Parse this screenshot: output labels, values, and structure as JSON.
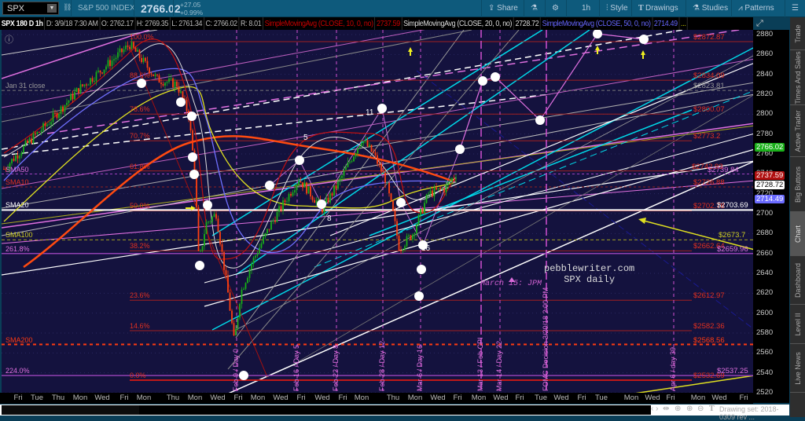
{
  "toolbar": {
    "symbol": "SPX",
    "name": "S&P 500 INDEX",
    "last": "2766.02",
    "change": "+27.05",
    "change_pct": "+0.99%",
    "share": "Share",
    "interval": "1h",
    "style": "Style",
    "drawings": "Drawings",
    "studies": "Studies",
    "patterns": "Patterns"
  },
  "infobar": {
    "title": "SPX 180 D 1h",
    "date": "D: 3/9/18 7:30 AM",
    "open": "O: 2762.17",
    "high": "H: 2769.35",
    "low": "L: 2761.34",
    "close": "C: 2766.02",
    "range": "R: 8.01",
    "sma10_label": "SimpleMovingAvg (CLOSE, 10, 0, no)",
    "sma10_value": "2737.59",
    "sma20_label": "SimpleMovingAvg (CLOSE, 20, 0, no)",
    "sma20_value": "2728.72",
    "sma50_label": "SimpleMovingAvg (CLOSE, 50, 0, no)",
    "sma50_value": "2714.49",
    "more": "..."
  },
  "price_axis": [
    "2880",
    "2860",
    "2840",
    "2820",
    "2800",
    "2780",
    "2760",
    "2740",
    "2720",
    "2700",
    "2680",
    "2660",
    "2640",
    "2620",
    "2600",
    "2580",
    "2560",
    "2540",
    "2520"
  ],
  "price_tags": {
    "last": "2766.02",
    "sma10": "2737.59",
    "sma20": "2728.72",
    "sma50": "2714.49"
  },
  "fib_levels": [
    {
      "pct": "100.0%",
      "price": "$2872.87"
    },
    {
      "pct": "88.6%",
      "price": "$2834.09"
    },
    {
      "pct": "78.6%",
      "price": "$2800.07"
    },
    {
      "pct": "70.7%",
      "price": "$2773.2"
    },
    {
      "pct": "61.8%",
      "price": "$2742.93"
    },
    {
      "pct": "50.0%",
      "price": "$2702.78"
    },
    {
      "pct": "38.2%",
      "price": "$2662.64"
    },
    {
      "pct": "23.6%",
      "price": "$2612.97"
    },
    {
      "pct": "14.6%",
      "price": "$2582.36"
    },
    {
      "pct": "0.0%",
      "price": "$2532.69"
    }
  ],
  "ext_levels": [
    {
      "pct": "261.8%",
      "price": "$2659.96"
    },
    {
      "pct": "224.0%",
      "price": "$2537.25"
    }
  ],
  "line_labels": {
    "jan31": "Jan 31 close",
    "jan31_price": "$2823.81",
    "sma50": "SMA50",
    "sma50_price": "$2739.84",
    "sma10": "SMA10",
    "sma10_price": "$2726.88",
    "sma20": "SMA20",
    "sma20_price": "$2703.69",
    "sma100": "SMA100",
    "sma100_price": "$2673.7",
    "sma200": "SMA200",
    "sma200_price": "$2568.56"
  },
  "wave_labels": [
    "5",
    "11",
    "8",
    "16"
  ],
  "events": [
    "Feb 9 / Day 0",
    "Feb 16 / Day 5",
    "Feb 22 / Day 8",
    "Feb 28 / Day 12",
    "Mar 6 / Day 16",
    "Mar 13 / Feb CPI",
    "Mar 14 / Day 22",
    "FOMC Decision 3/20/18 2:00 PM",
    "Apr 6 / day 39"
  ],
  "annotation": {
    "site": "pebblewriter.com",
    "subtitle": "SPX daily",
    "jpm": "March 15: JPM"
  },
  "time_axis": [
    "Fri",
    "Tue",
    "Thu",
    "Mon",
    "Wed",
    "Fri",
    "Mon",
    "Thu",
    "Mon",
    "Wed",
    "Fri",
    "Mon",
    "Wed",
    "Fri",
    "Wed",
    "Fri",
    "Mon",
    "Thu",
    "Mon",
    "Wed",
    "Fri",
    "Mon",
    "Wed",
    "Fri",
    "Tue",
    "Wed",
    "Fri",
    "Tue",
    "Mon",
    "Wed",
    "Fri",
    "Mon",
    "Wed",
    "Fri"
  ],
  "drawing_set": "Drawing set: 2018-0309 rev ...",
  "side_tabs": [
    "Trade",
    "Times And Sales",
    "Active Trader",
    "Big Buttons",
    "Chart",
    "Dashboard",
    "Level II",
    "Live News"
  ]
}
